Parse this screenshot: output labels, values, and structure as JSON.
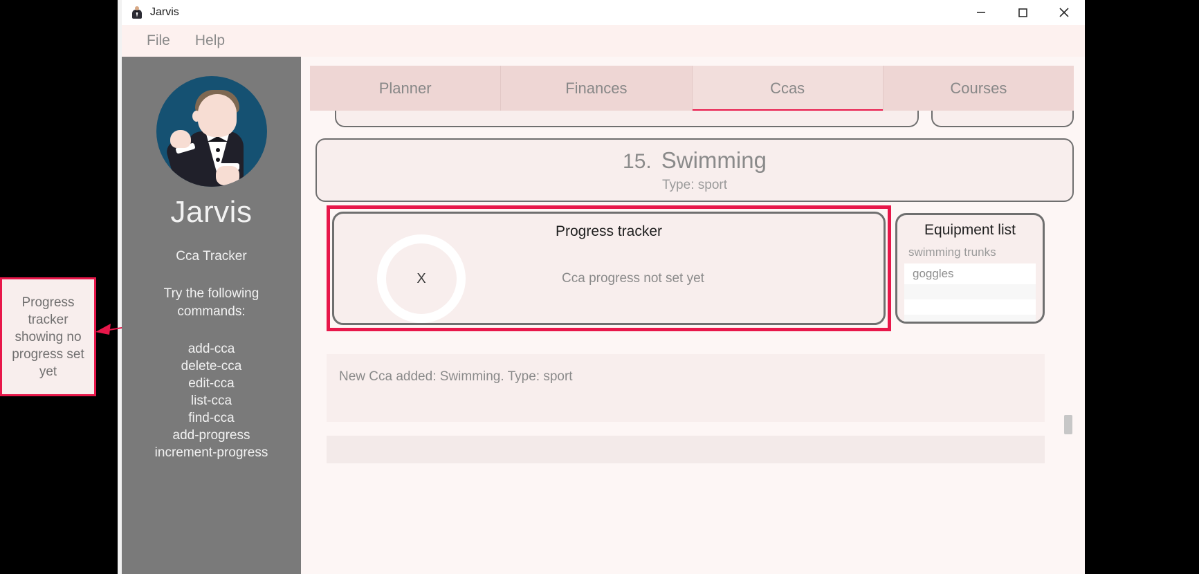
{
  "window": {
    "title": "Jarvis",
    "icon": "butler-icon",
    "controls": {
      "minimize": "minimize-icon",
      "maximize": "maximize-icon",
      "close": "close-icon"
    }
  },
  "menubar": {
    "items": [
      "File",
      "Help"
    ]
  },
  "sidebar": {
    "brand": "Jarvis",
    "avatar": "butler-avatar",
    "tracker_label": "Cca Tracker",
    "try_label": "Try the following commands:",
    "commands": [
      "add-cca",
      "delete-cca",
      "edit-cca",
      "list-cca",
      "find-cca",
      "add-progress",
      "increment-progress"
    ]
  },
  "tabs": [
    {
      "label": "Planner",
      "active": false
    },
    {
      "label": "Finances",
      "active": false
    },
    {
      "label": "Ccas",
      "active": true
    },
    {
      "label": "Courses",
      "active": false
    }
  ],
  "cca": {
    "index": "15.",
    "name": "Swimming",
    "type": "Type: sport"
  },
  "progress_tracker": {
    "title": "Progress tracker",
    "ring_value": "X",
    "message": "Cca progress not set yet"
  },
  "equipment": {
    "title": "Equipment list",
    "subtitle": "swimming trunks",
    "items": [
      "goggles",
      "",
      "",
      ""
    ]
  },
  "result": {
    "message": "New Cca added: Swimming. Type: sport"
  },
  "annotation": {
    "text": "Progress tracker showing no progress set yet",
    "accent": "#e8174a"
  },
  "colors": {
    "accent": "#e8174a",
    "sidebar_bg": "#7a7a7a",
    "content_bg": "#fdf6f5",
    "card_bg": "#f8eeed",
    "tab_bg": "#eed6d4",
    "avatar_bg": "#155172"
  }
}
